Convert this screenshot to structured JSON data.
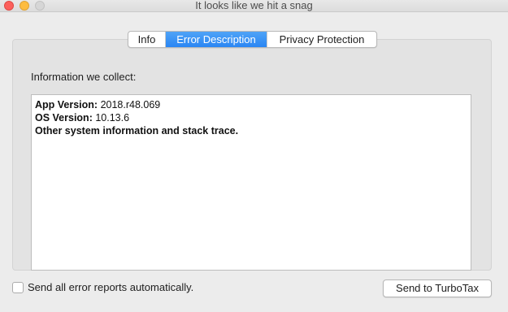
{
  "window": {
    "title": "It looks like we hit a snag"
  },
  "tabs": [
    {
      "label": "Info",
      "active": false
    },
    {
      "label": "Error Description",
      "active": true
    },
    {
      "label": "Privacy Protection",
      "active": false
    }
  ],
  "content": {
    "section_label": "Information we collect:",
    "app_version_label": "App Version:",
    "app_version_value": "2018.r48.069",
    "os_version_label": "OS Version:",
    "os_version_value": "10.13.6",
    "other_info": "Other system information and stack trace."
  },
  "footer": {
    "checkbox_label": "Send all error reports automatically.",
    "checkbox_checked": false,
    "send_button_label": "Send to TurboTax"
  },
  "colors": {
    "accent": "#2a86f3",
    "close": "#fc605c",
    "minimize": "#fdbc40",
    "zoom_disabled": "#d6d6d6"
  }
}
